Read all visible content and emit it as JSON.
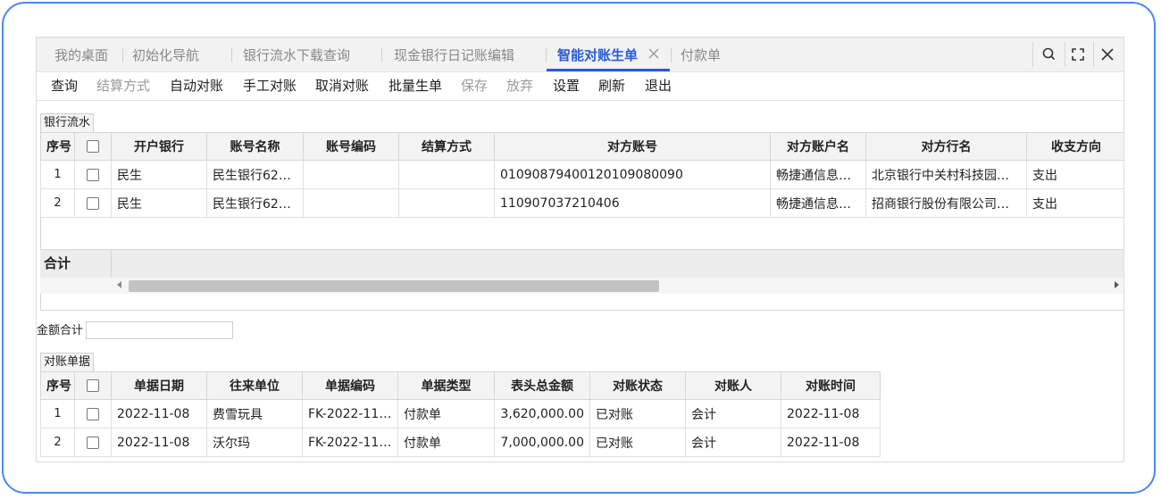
{
  "tabs": [
    {
      "label": "我的桌面"
    },
    {
      "label": "初始化导航"
    },
    {
      "label": "银行流水下载查询"
    },
    {
      "label": "现金银行日记账编辑"
    },
    {
      "label": "智能对账生单"
    },
    {
      "label": "付款单"
    }
  ],
  "active_tab_index": 4,
  "window_icons": [
    "search-icon",
    "expand-icon",
    "close-icon"
  ],
  "toolbar": {
    "items": [
      {
        "label": "查询",
        "enabled": true
      },
      {
        "label": "结算方式",
        "enabled": false
      },
      {
        "label": "自动对账",
        "enabled": true
      },
      {
        "label": "手工对账",
        "enabled": true
      },
      {
        "label": "取消对账",
        "enabled": true
      },
      {
        "label": "批量生单",
        "enabled": true
      },
      {
        "label": "保存",
        "enabled": false
      },
      {
        "label": "放弃",
        "enabled": false
      },
      {
        "label": "设置",
        "enabled": true
      },
      {
        "label": "刷新",
        "enabled": true
      },
      {
        "label": "退出",
        "enabled": true
      }
    ]
  },
  "bank_flow": {
    "group_label": "银行流水",
    "columns": [
      "序号",
      "",
      "开户银行",
      "账号名称",
      "账号编码",
      "结算方式",
      "对方账号",
      "对方账户名",
      "对方行名",
      "收支方向"
    ],
    "rows": [
      [
        "1",
        "",
        "民生",
        "民生银行62…",
        "",
        "",
        "0109087940012010908009​0",
        "畅捷通信息…",
        "北京银行中关村科技园…",
        "支出"
      ],
      [
        "2",
        "",
        "民生",
        "民生银行62…",
        "",
        "",
        "110907037210406",
        "畅捷通信息…",
        "招商银行股份有限公司…",
        "支出"
      ]
    ],
    "total_label": "合计"
  },
  "amount_total": {
    "label": "金额合计",
    "value": ""
  },
  "recon_docs": {
    "group_label": "对账单据",
    "columns": [
      "序号",
      "",
      "单据日期",
      "往来单位",
      "单据编码",
      "单据类型",
      "表头总金额",
      "对账状态",
      "对账人",
      "对账时间"
    ],
    "rows": [
      [
        "1",
        "",
        "2022-11-08",
        "费雪玩具",
        "FK-2022-11-…",
        "付款单",
        "3,620,000.00",
        "已对账",
        "会计",
        "2022-11-08"
      ],
      [
        "2",
        "",
        "2022-11-08",
        "沃尔玛",
        "FK-2022-11-…",
        "付款单",
        "7,000,000.00",
        "已对账",
        "会计",
        "2022-11-08"
      ]
    ]
  },
  "colors": {
    "frame": "#4a88ee",
    "accent": "#2a5bd7"
  }
}
